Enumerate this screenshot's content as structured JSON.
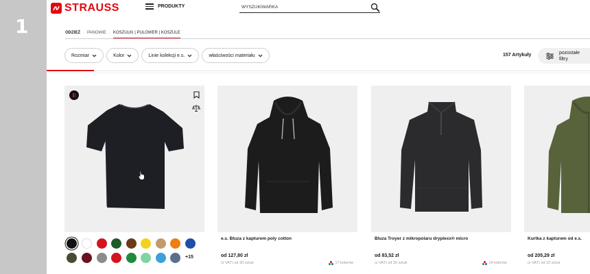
{
  "step": {
    "number": "1"
  },
  "header": {
    "brand": "STRAUSS",
    "products_label": "PRODUKTY",
    "search_label": "WYSZUKIWARKA"
  },
  "breadcrumb": [
    "ODZIEŻ",
    "PANOWIE",
    "KOSZULKI | PULOWER | KOSZULE"
  ],
  "filters": {
    "chips": [
      "Rozmiar",
      "Kolor",
      "Linie kolekcji e.s.",
      "właściwości materiału"
    ],
    "count": "157 Artykuły",
    "more_line1": "pozostałe",
    "more_line2": "filtry"
  },
  "products": [
    {
      "name": "",
      "price": "",
      "meta": "",
      "colors": ""
    },
    {
      "name": "e.s. Bluza z kapturem poly cotton",
      "price": "od 127,80 zł",
      "meta": "(z VAT) od 30 sztuk",
      "colors": "17 kolorów"
    },
    {
      "name": "Bluza Troyer z mikropolaru dryplexx® micro",
      "price": "od 83,52 zł",
      "meta": "(z VAT) od 30 sztuk",
      "colors": "14 kolorów"
    },
    {
      "name": "Kurtka z kapturem od e.s.",
      "price": "od 205,29 zł",
      "meta": "(z VAT) od 10 sztuk",
      "colors": ""
    }
  ],
  "swatches": {
    "colors": [
      "#111111",
      "#ffffff",
      "#d2141e",
      "#1f5a2a",
      "#6a3b1a",
      "#f2d21c",
      "#c59a6a",
      "#f07c13",
      "#1f4fa8",
      "#4a4a35",
      "#6a1020",
      "#8c8c8c",
      "#d2141e",
      "#1f8a3c",
      "#7fd6a0",
      "#3ea0dc",
      "#5a6f8c"
    ],
    "more": "+15"
  },
  "colors": {
    "accent": "#e30613"
  }
}
